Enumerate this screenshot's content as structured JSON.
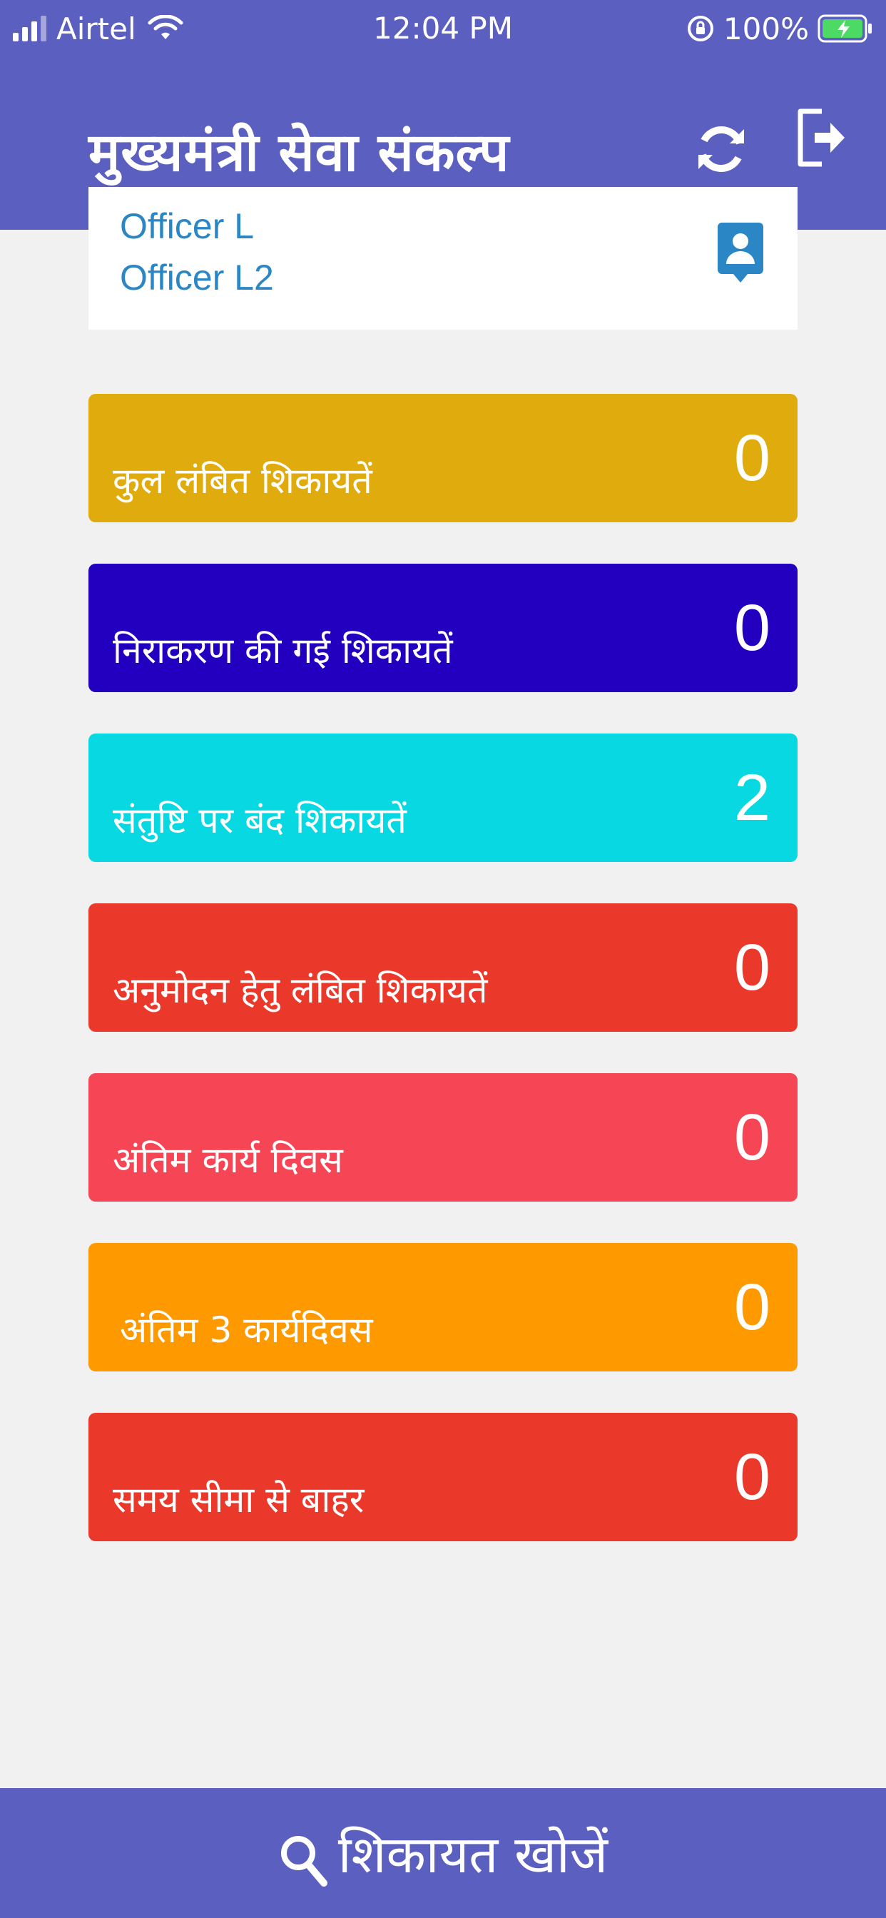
{
  "status_bar": {
    "carrier": "Airtel",
    "time": "12:04 PM",
    "battery": "100%"
  },
  "header": {
    "title": "मुख्यमंत्री सेवा संकल्प"
  },
  "user": {
    "name": "Officer L",
    "role": "Officer L2"
  },
  "stats": [
    {
      "label": "कुल लंबित शिकायतें",
      "count": "0",
      "color": "#e0ac0d"
    },
    {
      "label": "निराकरण की गई शिकायतें",
      "count": "0",
      "color": "#2300c0"
    },
    {
      "label": "संतुष्टि पर बंद शिकायतें",
      "count": "2",
      "color": "#07d8e2"
    },
    {
      "label": "अनुमोदन हेतु लंबित शिकायतें",
      "count": "0",
      "color": "#ea392b"
    },
    {
      "label": "अंतिम कार्य दिवस",
      "count": "0",
      "color": "#f64555"
    },
    {
      "label": "अंतिम 3 कार्यदिवस",
      "count": "0",
      "color": "#ff9900"
    },
    {
      "label": "समय सीमा से बाहर",
      "count": "0",
      "color": "#ea392b"
    }
  ],
  "footer": {
    "search_label": "शिकायत खोजें"
  },
  "colors": {
    "header": "#5b5fc0",
    "background": "#f1f1f1",
    "user_text": "#2a86c4"
  }
}
